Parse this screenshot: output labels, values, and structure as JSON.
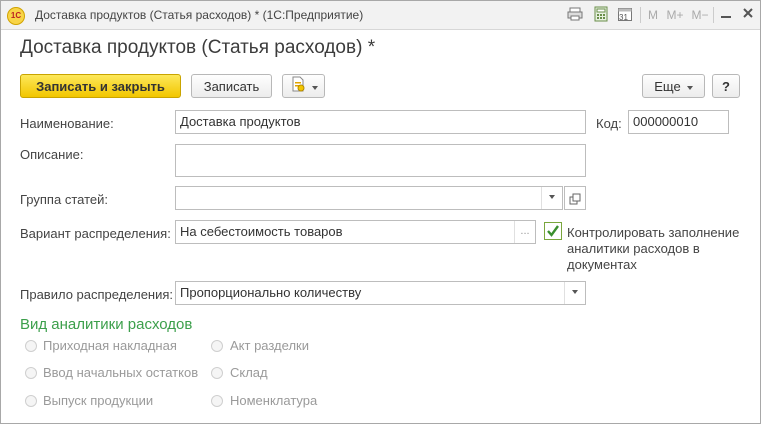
{
  "window": {
    "title": "Доставка продуктов (Статья расходов) * (1С:Предприятие)",
    "logo_text": "1С"
  },
  "titlebar_icons": [
    "print-icon",
    "calculator-icon",
    "calendar-icon",
    "memory-m-icon",
    "memory-plus-icon",
    "memory-minus-icon",
    "minimize-icon",
    "close-icon"
  ],
  "titlebar_labels": {
    "m": "M",
    "mplus": "M+",
    "mminus": "M−",
    "calendar_day": "31"
  },
  "form": {
    "title": "Доставка продуктов (Статья расходов) *"
  },
  "toolbar": {
    "save_close_label": "Записать и закрыть",
    "save_label": "Записать",
    "more_label": "Еще",
    "help_label": "?"
  },
  "fields": {
    "name_label": "Наименование:",
    "name_value": "Доставка продуктов",
    "code_label": "Код:",
    "code_value": "000000010",
    "description_label": "Описание:",
    "description_value": "",
    "group_label": "Группа статей:",
    "group_value": "",
    "variant_label": "Вариант распределения:",
    "variant_value": "На себестоимость товаров",
    "variant_btn": "...",
    "control_label_line1": "Контролировать заполнение",
    "control_label_line2": "аналитики расходов в",
    "control_label_line3": "документах",
    "control_checked": true,
    "rule_label": "Правило распределения:",
    "rule_value": "Пропорционально количеству"
  },
  "analytics": {
    "title": "Вид аналитики расходов",
    "options_left": [
      "Приходная накладная",
      "Ввод начальных остатков",
      "Выпуск продукции"
    ],
    "options_right": [
      "Акт разделки",
      "Склад",
      "Номенклатура"
    ]
  },
  "colors": {
    "primary_button": "#f5cf1b",
    "section_title": "#3c9f4b",
    "check_mark": "#3a8f2e"
  }
}
